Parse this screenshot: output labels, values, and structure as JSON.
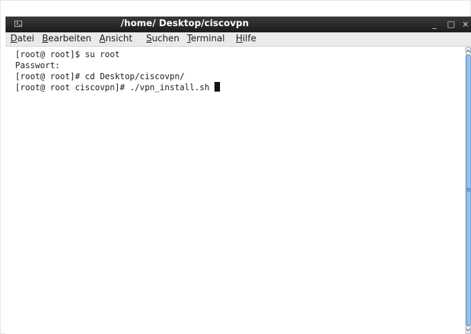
{
  "window": {
    "title": "/home/ Desktop/ciscovpn",
    "controls": {
      "minimize": "_",
      "maximize": "□",
      "close": "×"
    }
  },
  "menubar": {
    "items": [
      {
        "accel": "D",
        "rest": "atei"
      },
      {
        "accel": "B",
        "rest": "earbeiten"
      },
      {
        "accel": "A",
        "rest": "nsicht"
      },
      {
        "accel": "S",
        "rest": "uchen"
      },
      {
        "accel": "T",
        "rest": "erminal"
      },
      {
        "accel": "H",
        "rest": "ilfe"
      }
    ]
  },
  "terminal": {
    "lines": [
      "[root@ root]$ su root",
      "Passwort:",
      "[root@ root]# cd Desktop/ciscovpn/",
      "[root@ root ciscovpn]# ./vpn_install.sh "
    ]
  },
  "icons": {
    "window_icon": "terminal-icon",
    "scroll_up": "chevron-up-icon",
    "scroll_down": "chevron-down-icon"
  },
  "colors": {
    "titlebar": "#1c1c1c",
    "menubar": "#eaeaea",
    "scroll_thumb": "#8fbfe8"
  }
}
